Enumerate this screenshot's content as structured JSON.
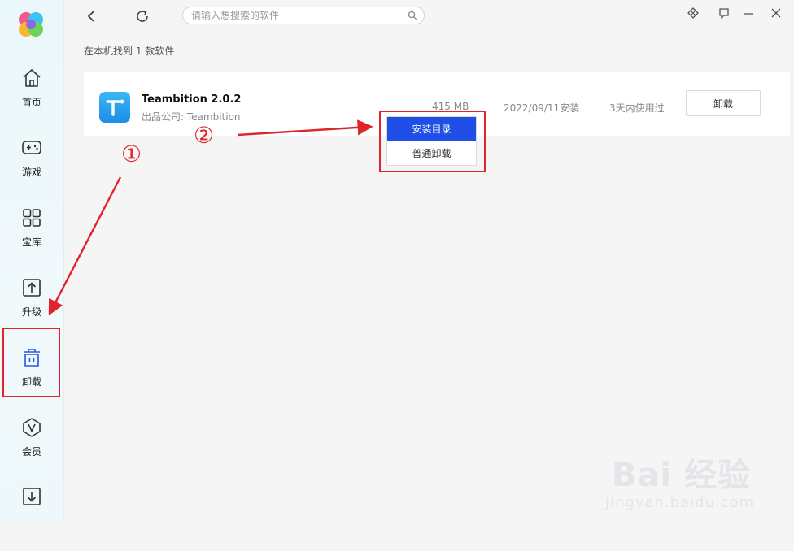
{
  "sidebar": {
    "items": [
      {
        "label": "首页",
        "icon": "home-icon"
      },
      {
        "label": "游戏",
        "icon": "gamepad-icon"
      },
      {
        "label": "宝库",
        "icon": "grid-icon"
      },
      {
        "label": "升级",
        "icon": "upgrade-icon"
      },
      {
        "label": "卸载",
        "icon": "trash-icon"
      },
      {
        "label": "会员",
        "icon": "vip-icon"
      },
      {
        "label": "",
        "icon": "download-icon"
      }
    ]
  },
  "search": {
    "placeholder": "请输入想搜索的软件"
  },
  "result": {
    "count_text": "在本机找到 1 款软件"
  },
  "app": {
    "name": "Teambition 2.0.2",
    "publisher": "出品公司: Teambition",
    "size": "415 MB",
    "install_date": "2022/09/11安装",
    "usage": "3天内使用过",
    "uninstall_label": "卸载"
  },
  "dropdown": {
    "items": [
      "安装目录",
      "普通卸载"
    ],
    "selected": "安装目录"
  },
  "annotations": {
    "step1": "①",
    "step2": "②"
  },
  "watermark": {
    "brand": "Bai 经验",
    "url": "jingyan.baidu.com"
  },
  "colors": {
    "accent": "#1f4fe6",
    "highlight": "#e0242b"
  }
}
